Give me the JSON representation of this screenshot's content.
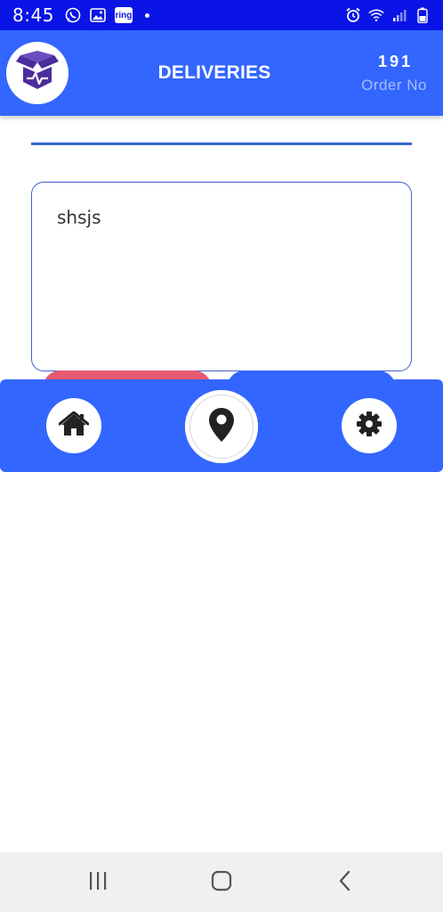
{
  "status_bar": {
    "time": "8:45",
    "ring_label": "ring"
  },
  "header": {
    "title": "DELIVERIES",
    "order_number": "191",
    "order_label": "Order No",
    "logo_icon": "open-box-icon"
  },
  "form": {
    "notes_text": "shsjs"
  },
  "bottom_nav": {
    "items": [
      {
        "icon": "home-icon"
      },
      {
        "icon": "map-pin-icon"
      },
      {
        "icon": "gear-icon"
      }
    ]
  },
  "colors": {
    "status_bar": "#0a14e6",
    "primary": "#3366ff",
    "cancel": "#e85a72",
    "logo_purple": "#4b2c9c"
  }
}
